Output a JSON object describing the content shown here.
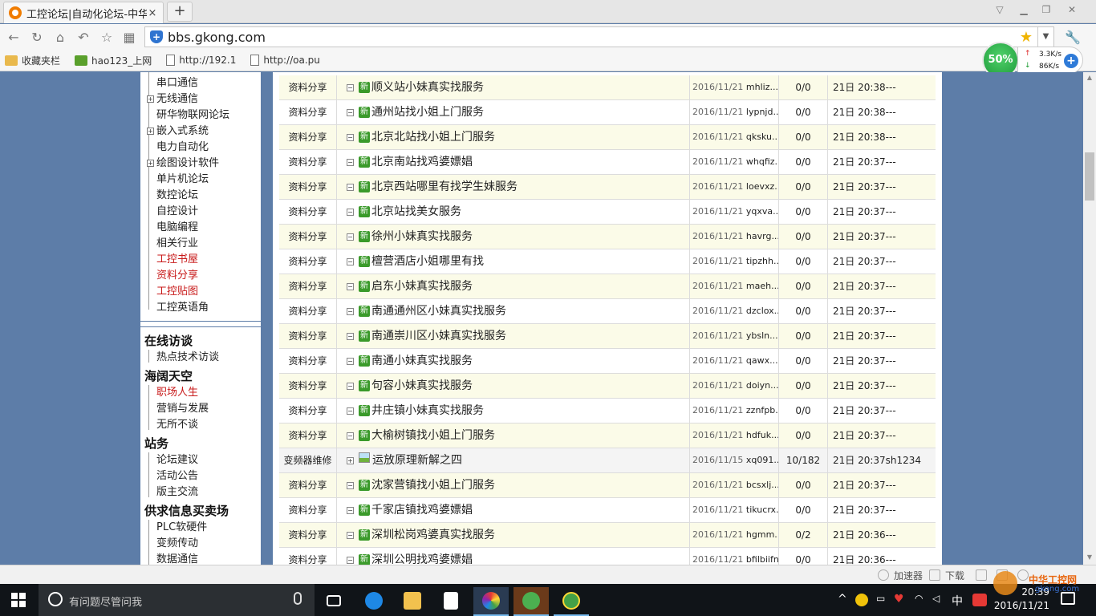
{
  "browser": {
    "tab_title": "工控论坛|自动化论坛-中华",
    "tab_close": "×",
    "new_tab": "+",
    "address": "bbs.gkong.com",
    "bookmarks": [
      "收藏夹栏",
      "hao123_上网",
      "http://192.1",
      "http://oa.pu"
    ],
    "speed": {
      "percent": "50%",
      "up": "3.3K/s",
      "down": "86K/s"
    }
  },
  "sidebar": {
    "tree_items": [
      {
        "label": "串口通信",
        "expandable": false,
        "red": false
      },
      {
        "label": "无线通信",
        "expandable": true,
        "red": false
      },
      {
        "label": "研华物联网论坛",
        "expandable": false,
        "red": false
      },
      {
        "label": "嵌入式系统",
        "expandable": true,
        "red": false
      },
      {
        "label": "电力自动化",
        "expandable": false,
        "red": false
      },
      {
        "label": "绘图设计软件",
        "expandable": true,
        "red": false
      },
      {
        "label": "单片机论坛",
        "expandable": false,
        "red": false
      },
      {
        "label": "数控论坛",
        "expandable": false,
        "red": false
      },
      {
        "label": "自控设计",
        "expandable": false,
        "red": false
      },
      {
        "label": "电脑编程",
        "expandable": false,
        "red": false
      },
      {
        "label": "相关行业",
        "expandable": false,
        "red": false
      },
      {
        "label": "工控书屋",
        "expandable": false,
        "red": true
      },
      {
        "label": "资料分享",
        "expandable": false,
        "red": true
      },
      {
        "label": "工控贴图",
        "expandable": false,
        "red": true
      },
      {
        "label": "工控英语角",
        "expandable": false,
        "red": false
      }
    ],
    "sections": [
      {
        "title": "在线访谈",
        "items": [
          {
            "label": "热点技术访谈",
            "red": false
          }
        ]
      },
      {
        "title": "海阔天空",
        "items": [
          {
            "label": "职场人生",
            "red": true
          },
          {
            "label": "营销与发展",
            "red": false
          },
          {
            "label": "无所不谈",
            "red": false
          }
        ]
      },
      {
        "title": "站务",
        "items": [
          {
            "label": "论坛建议",
            "red": false
          },
          {
            "label": "活动公告",
            "red": false
          },
          {
            "label": "版主交流",
            "red": false
          }
        ]
      },
      {
        "title": "供求信息买卖场",
        "items": [
          {
            "label": "PLC软硬件",
            "red": false
          },
          {
            "label": "变频传动",
            "red": false
          },
          {
            "label": "数据通信",
            "red": false
          }
        ]
      }
    ]
  },
  "threads": [
    {
      "cat": "资料分享",
      "tree": "⊟",
      "badge": "新",
      "title": "顺义站小妹真实找服务",
      "date": "2016/11/21",
      "user": "mhliz...",
      "replies": "0/0",
      "last": "21日 20:38",
      "last_user": "---",
      "hl": true
    },
    {
      "cat": "资料分享",
      "tree": "⊟",
      "badge": "新",
      "title": "通州站找小姐上门服务",
      "date": "2016/11/21",
      "user": "lypnjd...",
      "replies": "0/0",
      "last": "21日 20:38",
      "last_user": "---",
      "hl": false
    },
    {
      "cat": "资料分享",
      "tree": "⊟",
      "badge": "新",
      "title": "北京北站找小姐上门服务",
      "date": "2016/11/21",
      "user": "qksku...",
      "replies": "0/0",
      "last": "21日 20:38",
      "last_user": "---",
      "hl": true
    },
    {
      "cat": "资料分享",
      "tree": "⊟",
      "badge": "新",
      "title": "北京南站找鸡婆嫖娼",
      "date": "2016/11/21",
      "user": "whqfiz...",
      "replies": "0/0",
      "last": "21日 20:37",
      "last_user": "---",
      "hl": false
    },
    {
      "cat": "资料分享",
      "tree": "⊟",
      "badge": "新",
      "title": "北京西站哪里有找学生妹服务",
      "date": "2016/11/21",
      "user": "loevxz...",
      "replies": "0/0",
      "last": "21日 20:37",
      "last_user": "---",
      "hl": true
    },
    {
      "cat": "资料分享",
      "tree": "⊟",
      "badge": "新",
      "title": "北京站找美女服务",
      "date": "2016/11/21",
      "user": "yqxva...",
      "replies": "0/0",
      "last": "21日 20:37",
      "last_user": "---",
      "hl": false
    },
    {
      "cat": "资料分享",
      "tree": "⊟",
      "badge": "新",
      "title": "徐州小妹真实找服务",
      "date": "2016/11/21",
      "user": "havrg...",
      "replies": "0/0",
      "last": "21日 20:37",
      "last_user": "---",
      "hl": true
    },
    {
      "cat": "资料分享",
      "tree": "⊟",
      "badge": "新",
      "title": "檀营酒店小姐哪里有找",
      "date": "2016/11/21",
      "user": "tipzhh...",
      "replies": "0/0",
      "last": "21日 20:37",
      "last_user": "---",
      "hl": false
    },
    {
      "cat": "资料分享",
      "tree": "⊟",
      "badge": "新",
      "title": "启东小妹真实找服务",
      "date": "2016/11/21",
      "user": "maeh...",
      "replies": "0/0",
      "last": "21日 20:37",
      "last_user": "---",
      "hl": true
    },
    {
      "cat": "资料分享",
      "tree": "⊟",
      "badge": "新",
      "title": "南通通州区小妹真实找服务",
      "date": "2016/11/21",
      "user": "dzclox...",
      "replies": "0/0",
      "last": "21日 20:37",
      "last_user": "---",
      "hl": false
    },
    {
      "cat": "资料分享",
      "tree": "⊟",
      "badge": "新",
      "title": "南通崇川区小妹真实找服务",
      "date": "2016/11/21",
      "user": "ybsln...",
      "replies": "0/0",
      "last": "21日 20:37",
      "last_user": "---",
      "hl": true
    },
    {
      "cat": "资料分享",
      "tree": "⊟",
      "badge": "新",
      "title": "南通小妹真实找服务",
      "date": "2016/11/21",
      "user": "qawx...",
      "replies": "0/0",
      "last": "21日 20:37",
      "last_user": "---",
      "hl": false
    },
    {
      "cat": "资料分享",
      "tree": "⊟",
      "badge": "新",
      "title": "句容小妹真实找服务",
      "date": "2016/11/21",
      "user": "doiyn...",
      "replies": "0/0",
      "last": "21日 20:37",
      "last_user": "---",
      "hl": true
    },
    {
      "cat": "资料分享",
      "tree": "⊟",
      "badge": "新",
      "title": "井庄镇小妹真实找服务",
      "date": "2016/11/21",
      "user": "zznfpb...",
      "replies": "0/0",
      "last": "21日 20:37",
      "last_user": "---",
      "hl": false
    },
    {
      "cat": "资料分享",
      "tree": "⊟",
      "badge": "新",
      "title": "大榆树镇找小姐上门服务",
      "date": "2016/11/21",
      "user": "hdfuk...",
      "replies": "0/0",
      "last": "21日 20:37",
      "last_user": "---",
      "hl": true
    },
    {
      "cat": "变频器维修",
      "tree": "⊞",
      "badge": "",
      "title": "运放原理新解之四",
      "date": "2016/11/15",
      "user": "xq091...",
      "replies": "10/182",
      "last": "21日 20:37",
      "last_user": "sh1234",
      "hl": false,
      "gray": true
    },
    {
      "cat": "资料分享",
      "tree": "⊟",
      "badge": "新",
      "title": "沈家营镇找小姐上门服务",
      "date": "2016/11/21",
      "user": "bcsxlj...",
      "replies": "0/0",
      "last": "21日 20:37",
      "last_user": "---",
      "hl": true
    },
    {
      "cat": "资料分享",
      "tree": "⊟",
      "badge": "新",
      "title": "千家店镇找鸡婆嫖娼",
      "date": "2016/11/21",
      "user": "tikucrx...",
      "replies": "0/0",
      "last": "21日 20:37",
      "last_user": "---",
      "hl": false
    },
    {
      "cat": "资料分享",
      "tree": "⊟",
      "badge": "新",
      "title": "深圳松岗鸡婆真实找服务",
      "date": "2016/11/21",
      "user": "hgmm...",
      "replies": "0/2",
      "last": "21日 20:36",
      "last_user": "---",
      "hl": true
    },
    {
      "cat": "资料分享",
      "tree": "⊟",
      "badge": "新",
      "title": "深圳公明找鸡婆嫖娼",
      "date": "2016/11/21",
      "user": "bfilbiifn...",
      "replies": "0/0",
      "last": "21日 20:36",
      "last_user": "---",
      "hl": false
    }
  ],
  "statusbar": {
    "accelerator": "加速器",
    "download": "下载"
  },
  "taskbar": {
    "search_placeholder": "有问题尽管问我",
    "ime": "中",
    "time": "20:39",
    "date": "2016/11/21",
    "watermark_1": "中华工控网",
    "watermark_2": "gkong.com"
  }
}
